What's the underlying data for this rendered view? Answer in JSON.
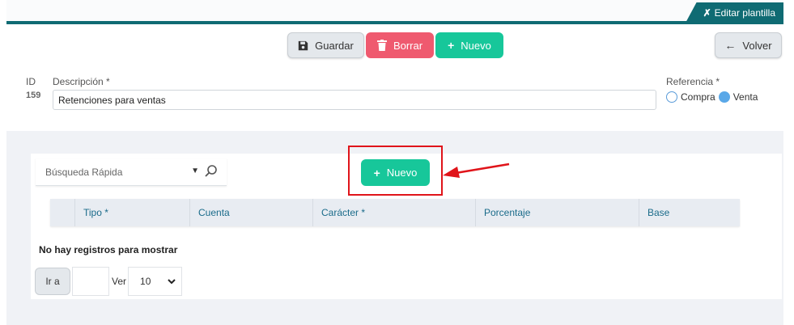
{
  "header": {
    "edit_template_label": "Editar plantilla"
  },
  "toolbar": {
    "save_label": "Guardar",
    "delete_label": "Borrar",
    "new_label": "Nuevo",
    "back_label": "Volver"
  },
  "form": {
    "id_label": "ID",
    "id_value": "159",
    "description_label": "Descripción *",
    "description_value": "Retenciones para ventas",
    "reference_label": "Referencia *",
    "reference_options": [
      "Compra",
      "Venta"
    ],
    "reference_selected": "Venta"
  },
  "grid": {
    "search_placeholder": "Búsqueda Rápida",
    "new_label": "Nuevo",
    "columns": [
      "Tipo *",
      "Cuenta",
      "Carácter *",
      "Porcentaje",
      "Base"
    ],
    "empty_message": "No hay registros para mostrar",
    "goto_label": "Ir a",
    "view_label": "Ver",
    "page_size": "10"
  },
  "colors": {
    "teal": "#0f6b73",
    "green": "#17c79a",
    "red": "#ef5a6f",
    "highlight": "#e0141a"
  }
}
